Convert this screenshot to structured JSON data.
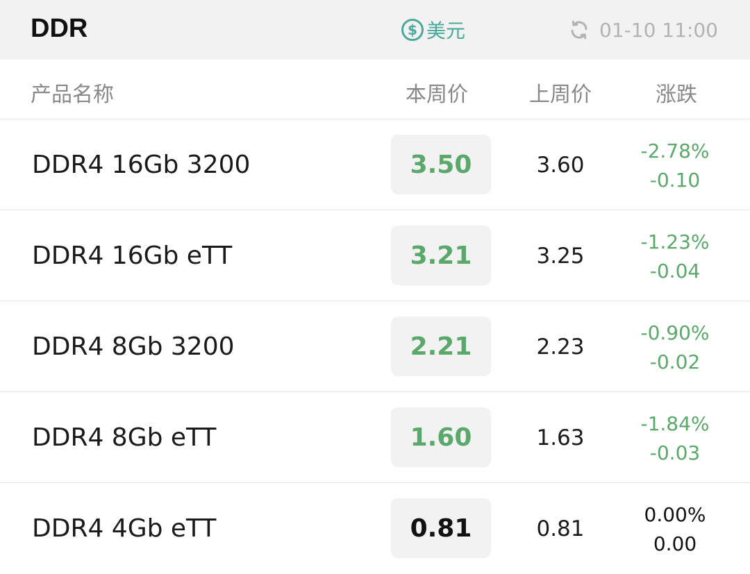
{
  "header": {
    "title": "DDR",
    "currency_symbol": "$",
    "currency_label": "美元",
    "timestamp": "01-10 11:00"
  },
  "columns": {
    "name": "产品名称",
    "current": "本周价",
    "previous": "上周价",
    "change": "涨跌"
  },
  "colors": {
    "down": "#5aa86a",
    "flat": "#111111",
    "accent": "#4aa99d"
  },
  "rows": [
    {
      "name": "DDR4 16Gb 3200",
      "current": "3.50",
      "previous": "3.60",
      "change_pct": "-2.78%",
      "change_abs": "-0.10",
      "trend": "down"
    },
    {
      "name": "DDR4 16Gb eTT",
      "current": "3.21",
      "previous": "3.25",
      "change_pct": "-1.23%",
      "change_abs": "-0.04",
      "trend": "down"
    },
    {
      "name": "DDR4 8Gb 3200",
      "current": "2.21",
      "previous": "2.23",
      "change_pct": "-0.90%",
      "change_abs": "-0.02",
      "trend": "down"
    },
    {
      "name": "DDR4 8Gb eTT",
      "current": "1.60",
      "previous": "1.63",
      "change_pct": "-1.84%",
      "change_abs": "-0.03",
      "trend": "down"
    },
    {
      "name": "DDR4 4Gb eTT",
      "current": "0.81",
      "previous": "0.81",
      "change_pct": "0.00%",
      "change_abs": "0.00",
      "trend": "flat"
    }
  ]
}
